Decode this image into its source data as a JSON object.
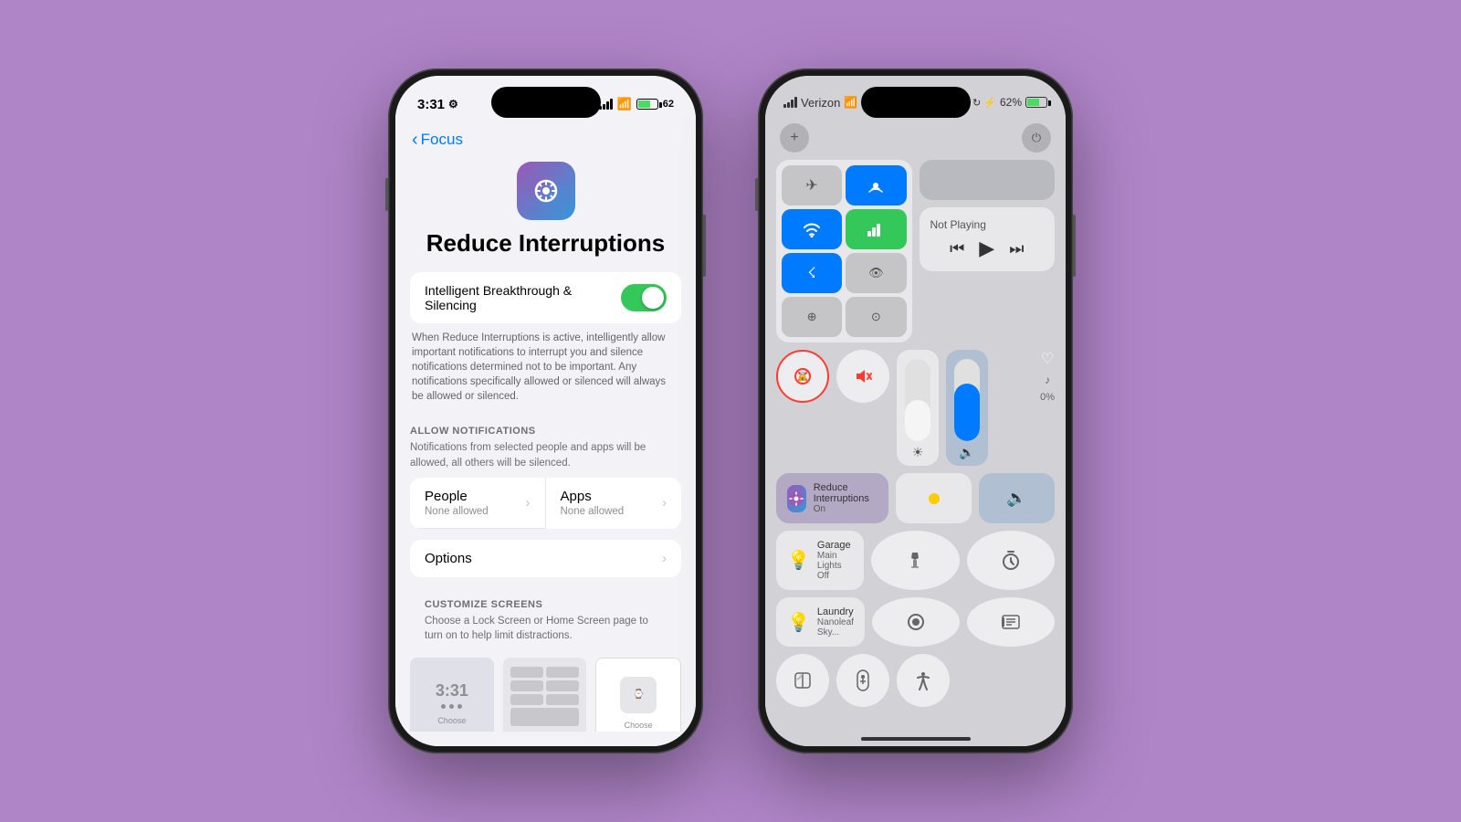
{
  "background_color": "#b085c8",
  "phone1": {
    "status_time": "3:31",
    "battery_pct": "62",
    "back_label": "Focus",
    "screen_title": "Reduce Interruptions",
    "app_icon_emoji": "⚙️",
    "toggle_label": "Intelligent Breakthrough & Silencing",
    "toggle_state": true,
    "toggle_description": "When Reduce Interruptions is active, intelligently allow important notifications to interrupt you and silence notifications determined not to be important. Any notifications specifically allowed or silenced will always be allowed or silenced.",
    "allow_notifications_header": "ALLOW NOTIFICATIONS",
    "allow_notifications_desc": "Notifications from selected people and apps will be allowed, all others will be silenced.",
    "people_label": "People",
    "people_sub": "None allowed",
    "apps_label": "Apps",
    "apps_sub": "None allowed",
    "options_label": "Options",
    "customize_header": "CUSTOMIZE SCREENS",
    "customize_desc": "Choose a Lock Screen or Home Screen page to turn on to help limit distractions.",
    "choose_label": "Choose",
    "screen1_time": "3:31",
    "bottom_bar": "─────"
  },
  "phone2": {
    "carrier": "Verizon",
    "battery_pct": "62%",
    "connectivity": {
      "airplane": "✈",
      "hotspot": "📶",
      "display": "□",
      "airplay": "⬆",
      "wifi": "WiFi",
      "cellular": "Cell",
      "bluetooth": "BT",
      "extra1": "👁",
      "extra2": "⊕"
    },
    "media_title": "Not Playing",
    "media_prev": "⏮",
    "media_play": "▶",
    "media_next": "⏭",
    "lock_icon": "🔒",
    "mute_icon": "🔔",
    "focus_name": "Reduce Interruptions",
    "focus_status": "On",
    "brightness_icon": "☀",
    "volume_icon": "🔊",
    "garage_label": "Garage",
    "garage_sub": "Main Lights Off",
    "torch_icon": "🔦",
    "timer_icon": "⏱",
    "laundry_label": "Laundry",
    "laundry_sub": "Nanoleaf Sky...",
    "record_icon": "⏺",
    "news_icon": "📰",
    "dark_icon": "◑",
    "remote_icon": "📺",
    "accessibility_icon": "♿"
  }
}
